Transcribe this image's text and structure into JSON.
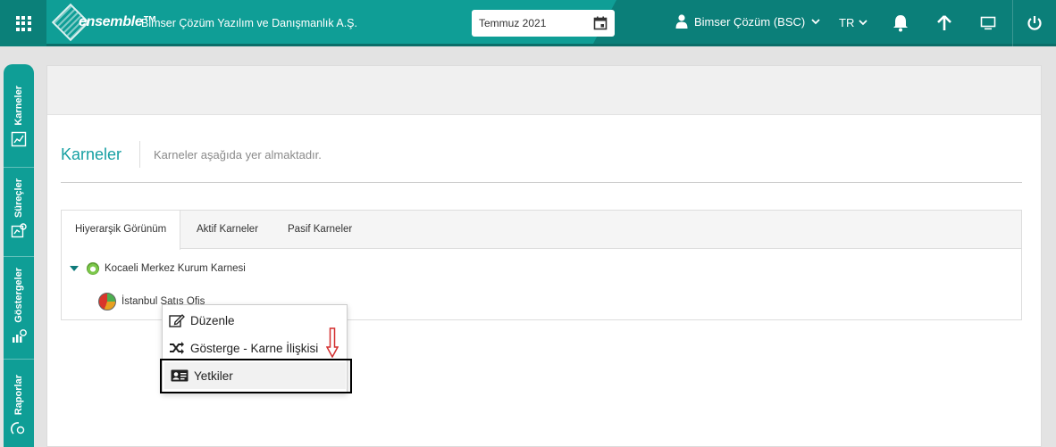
{
  "header": {
    "logo_text": "ensemble™",
    "company": "Bimser Çözüm Yazılım ve Danışmanlık A.Ş.",
    "date_value": "Temmuz 2021",
    "user_name": "Bimser Çözüm (BSC)",
    "language": "TR",
    "accent": "#0f9e96"
  },
  "sidebar": {
    "items": [
      {
        "label": "Karneler",
        "icon": "scorecard-icon"
      },
      {
        "label": "Süreçler",
        "icon": "process-icon"
      },
      {
        "label": "Göstergeler",
        "icon": "indicator-icon"
      },
      {
        "label": "Raporlar",
        "icon": "report-icon"
      }
    ]
  },
  "page": {
    "title": "Karneler",
    "subtitle": "Karneler aşağıda yer almaktadır."
  },
  "tabs": [
    {
      "label": "Hiyerarşik Görünüm",
      "active": true
    },
    {
      "label": "Aktif Karneler",
      "active": false
    },
    {
      "label": "Pasif Karneler",
      "active": false
    }
  ],
  "tree": {
    "root": {
      "label": "Kocaeli Merkez Kurum Karnesi",
      "status_color": "#6fbf3c"
    },
    "child": {
      "label": "İstanbul Satış Ofis",
      "status_color": "#e8a020"
    }
  },
  "context_menu": {
    "items": [
      {
        "label": "Düzenle",
        "icon": "edit-icon"
      },
      {
        "label": "Gösterge - Karne İlişkisi",
        "icon": "shuffle-icon"
      },
      {
        "label": "Yetkiler",
        "icon": "id-card-icon"
      }
    ]
  }
}
